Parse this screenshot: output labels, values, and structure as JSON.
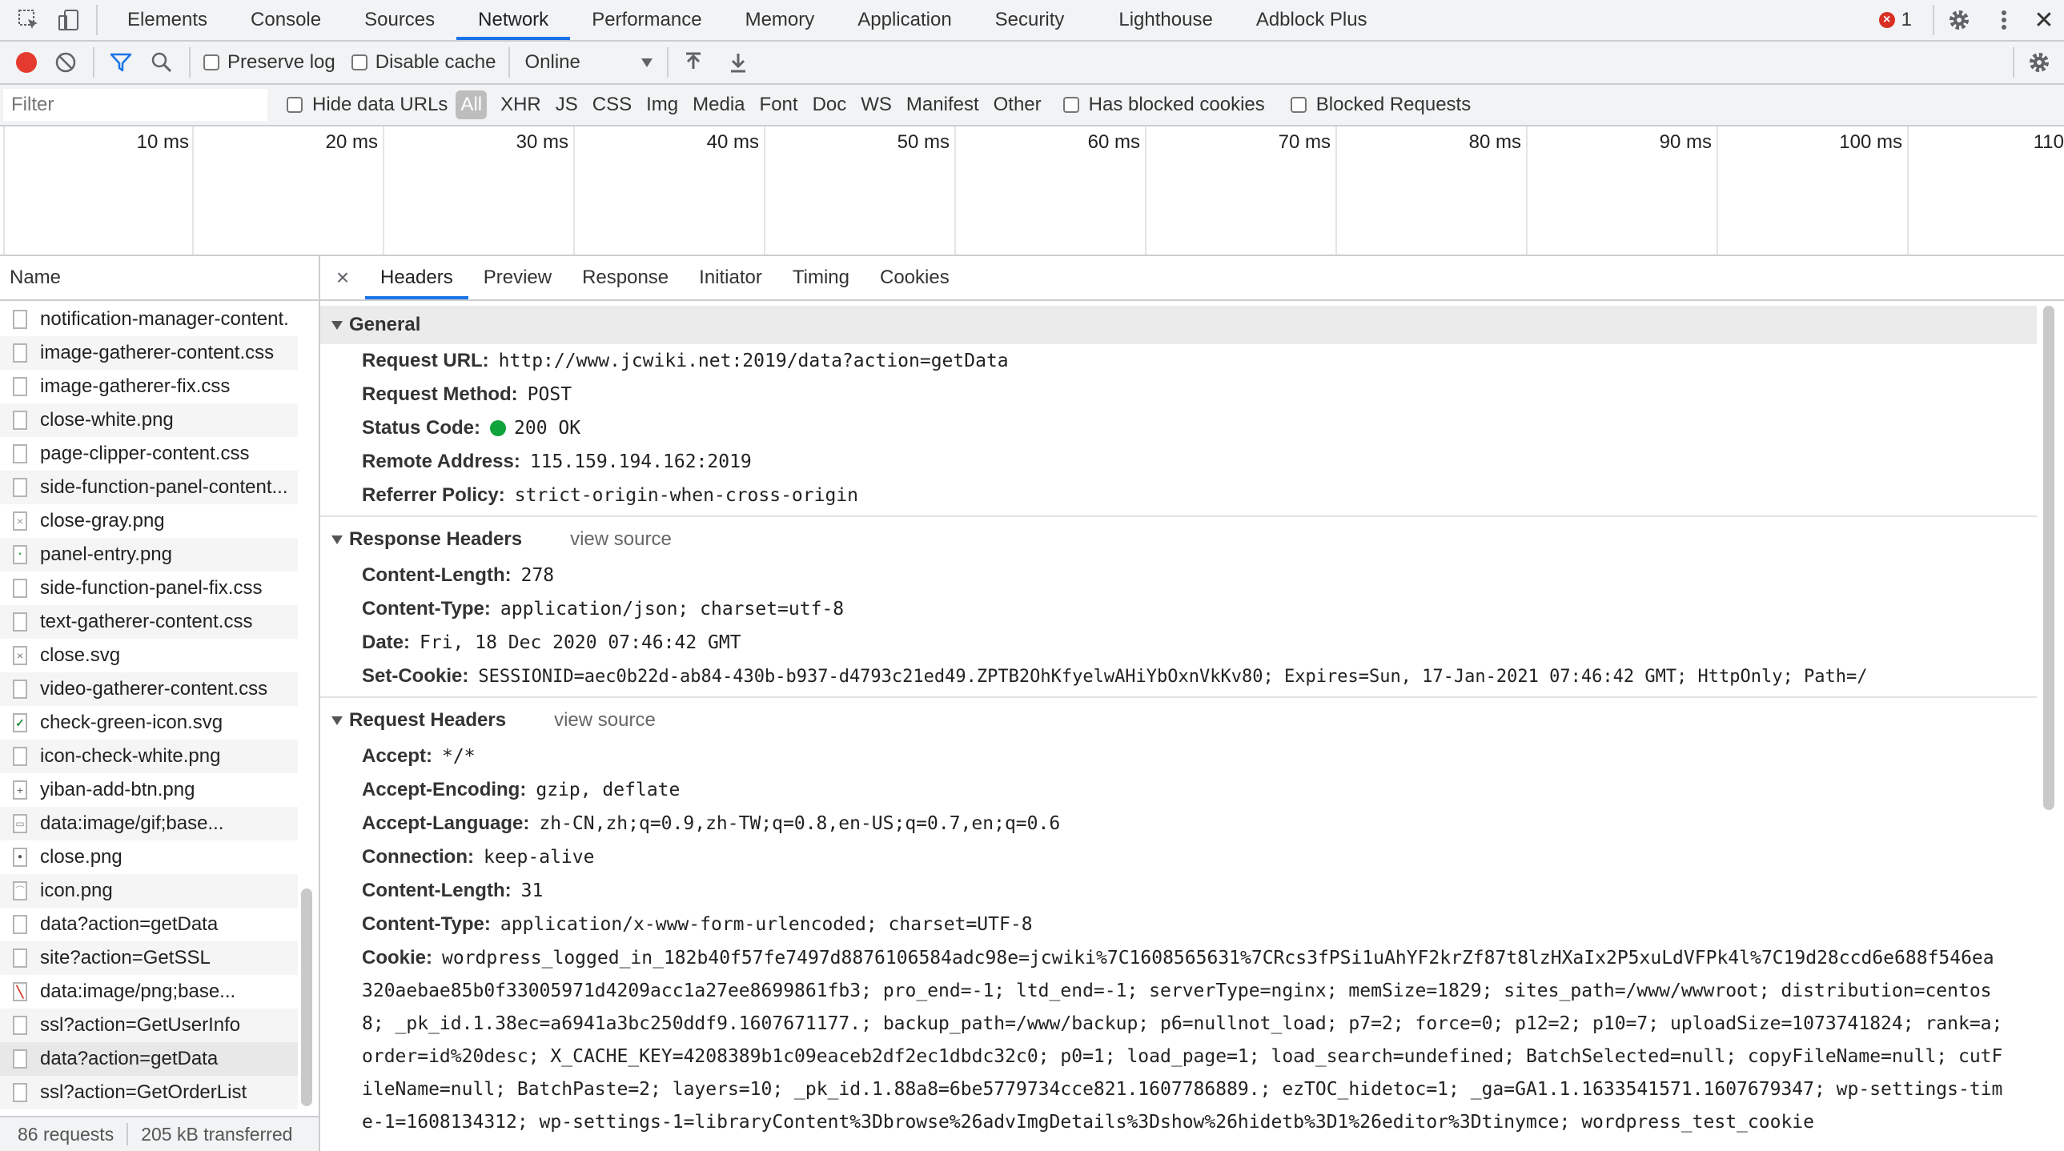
{
  "topbar": {
    "tabs": [
      "Elements",
      "Console",
      "Sources",
      "Network",
      "Performance",
      "Memory",
      "Application",
      "Security",
      "Lighthouse",
      "Adblock Plus"
    ],
    "active_tab": "Network",
    "error_count": "1"
  },
  "toolbar": {
    "preserve_log": "Preserve log",
    "disable_cache": "Disable cache",
    "throttling": "Online"
  },
  "filterbar": {
    "placeholder": "Filter",
    "hide_data_urls": "Hide data URLs",
    "types": [
      "All",
      "XHR",
      "JS",
      "CSS",
      "Img",
      "Media",
      "Font",
      "Doc",
      "WS",
      "Manifest",
      "Other"
    ],
    "has_blocked_cookies": "Has blocked cookies",
    "blocked_requests": "Blocked Requests"
  },
  "overview": {
    "ticks": [
      "10 ms",
      "20 ms",
      "30 ms",
      "40 ms",
      "50 ms",
      "60 ms",
      "70 ms",
      "80 ms",
      "90 ms",
      "100 ms",
      "110"
    ]
  },
  "left": {
    "column_header": "Name",
    "items": [
      {
        "name": "notification-manager-content.",
        "icon": ""
      },
      {
        "name": "image-gatherer-content.css",
        "icon": ""
      },
      {
        "name": "image-gatherer-fix.css",
        "icon": ""
      },
      {
        "name": "close-white.png",
        "icon": ""
      },
      {
        "name": "page-clipper-content.css",
        "icon": ""
      },
      {
        "name": "side-function-panel-content...",
        "icon": ""
      },
      {
        "name": "close-gray.png",
        "icon": "×"
      },
      {
        "name": "panel-entry.png",
        "icon": "▪"
      },
      {
        "name": "side-function-panel-fix.css",
        "icon": ""
      },
      {
        "name": "text-gatherer-content.css",
        "icon": ""
      },
      {
        "name": "close.svg",
        "icon": "×"
      },
      {
        "name": "video-gatherer-content.css",
        "icon": ""
      },
      {
        "name": "check-green-icon.svg",
        "icon": "✓"
      },
      {
        "name": "icon-check-white.png",
        "icon": ""
      },
      {
        "name": "yiban-add-btn.png",
        "icon": "+"
      },
      {
        "name": "data:image/gif;base...",
        "icon": "▭"
      },
      {
        "name": "close.png",
        "icon": "●"
      },
      {
        "name": "icon.png",
        "icon": "⌒"
      },
      {
        "name": "data?action=getData",
        "icon": ""
      },
      {
        "name": "site?action=GetSSL",
        "icon": ""
      },
      {
        "name": "data:image/png;base...",
        "icon": "╲"
      },
      {
        "name": "ssl?action=GetUserInfo",
        "icon": ""
      },
      {
        "name": "data?action=getData",
        "icon": ""
      },
      {
        "name": "ssl?action=GetOrderList",
        "icon": ""
      }
    ],
    "footer_requests": "86 requests",
    "footer_transferred": "205 kB transferred"
  },
  "detail": {
    "close": "×",
    "tabs": [
      "Headers",
      "Preview",
      "Response",
      "Initiator",
      "Timing",
      "Cookies"
    ],
    "active_tab": "Headers",
    "general": {
      "title": "General",
      "rows": [
        {
          "k": "Request URL:",
          "v": "http://www.jcwiki.net:2019/data?action=getData"
        },
        {
          "k": "Request Method:",
          "v": "POST"
        },
        {
          "k": "Status Code:",
          "v": "200 OK"
        },
        {
          "k": "Remote Address:",
          "v": "115.159.194.162:2019"
        },
        {
          "k": "Referrer Policy:",
          "v": "strict-origin-when-cross-origin"
        }
      ]
    },
    "response_headers": {
      "title": "Response Headers",
      "view_source": "view source",
      "rows": [
        {
          "k": "Content-Length:",
          "v": "278"
        },
        {
          "k": "Content-Type:",
          "v": "application/json; charset=utf-8"
        },
        {
          "k": "Date:",
          "v": "Fri, 18 Dec 2020 07:46:42 GMT"
        },
        {
          "k": "Set-Cookie:",
          "v": "SESSIONID=aec0b22d-ab84-430b-b937-d4793c21ed49.ZPTB2OhKfyelwAHiYbOxnVkKv80; Expires=Sun, 17-Jan-2021 07:46:42 GMT; HttpOnly; Path=/"
        }
      ]
    },
    "request_headers": {
      "title": "Request Headers",
      "view_source": "view source",
      "rows": [
        {
          "k": "Accept:",
          "v": "*/*"
        },
        {
          "k": "Accept-Encoding:",
          "v": "gzip, deflate"
        },
        {
          "k": "Accept-Language:",
          "v": "zh-CN,zh;q=0.9,zh-TW;q=0.8,en-US;q=0.7,en;q=0.6"
        },
        {
          "k": "Connection:",
          "v": "keep-alive"
        },
        {
          "k": "Content-Length:",
          "v": "31"
        },
        {
          "k": "Content-Type:",
          "v": "application/x-www-form-urlencoded; charset=UTF-8"
        }
      ],
      "cookie_key": "Cookie:",
      "cookie_value": "wordpress_logged_in_182b40f57fe7497d8876106584adc98e=jcwiki%7C1608565631%7CRcs3fPSi1uAhYF2krZf87t8lzHXaIx2P5xuLdVFPk4l%7C19d28ccd6e688f546ea320aebae85b0f33005971d4209acc1a27ee8699861fb3; pro_end=-1; ltd_end=-1; serverType=nginx; memSize=1829; sites_path=/www/wwwroot; distribution=centos8; _pk_id.1.38ec=a6941a3bc250ddf9.1607671177.; backup_path=/www/backup; p6=nullnot_load; p7=2; force=0; p12=2; p10=7; uploadSize=1073741824; rank=a; order=id%20desc; X_CACHE_KEY=4208389b1c09eaceb2df2ec1dbdc32c0; p0=1; load_page=1; load_search=undefined; BatchSelected=null; copyFileName=null; cutFileName=null; BatchPaste=2; layers=10; _pk_id.1.88a8=6be5779734cce821.1607786889.; ezTOC_hidetoc=1; _ga=GA1.1.1633541571.1607679347; wp-settings-time-1=1608134312; wp-settings-1=libraryContent%3Dbrowse%26advImgDetails%3Dshow%26hidetb%3D1%26editor%3Dtinymce; wordpress_test_cookie"
    }
  }
}
